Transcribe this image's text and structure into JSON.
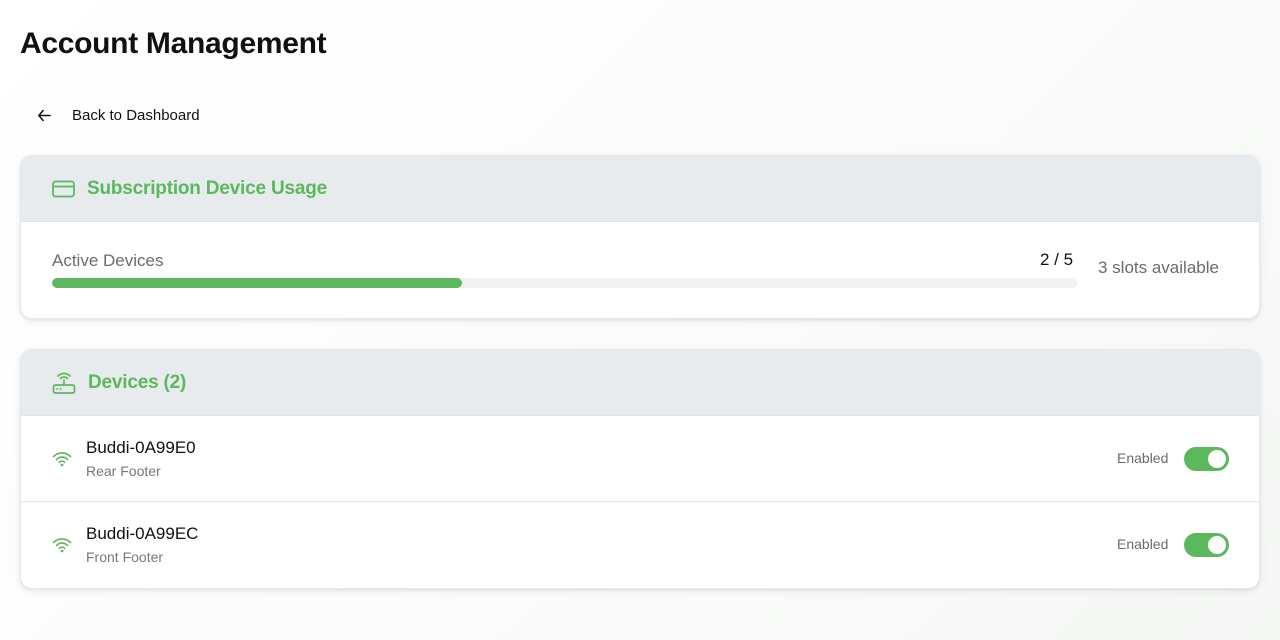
{
  "page": {
    "title": "Account Management"
  },
  "nav": {
    "back_label": "Back to Dashboard"
  },
  "colors": {
    "accent": "#5cb85c",
    "header_bg": "#e8ebee"
  },
  "usage": {
    "title": "Subscription Device Usage",
    "label": "Active Devices",
    "count": "2 / 5",
    "used": 2,
    "total": 5,
    "slots_available": "3 slots available"
  },
  "devices": {
    "title": "Devices (2)",
    "items": [
      {
        "name": "Buddi-0A99E0",
        "location": "Rear Footer",
        "status": "Enabled",
        "enabled": true
      },
      {
        "name": "Buddi-0A99EC",
        "location": "Front Footer",
        "status": "Enabled",
        "enabled": true
      }
    ]
  }
}
